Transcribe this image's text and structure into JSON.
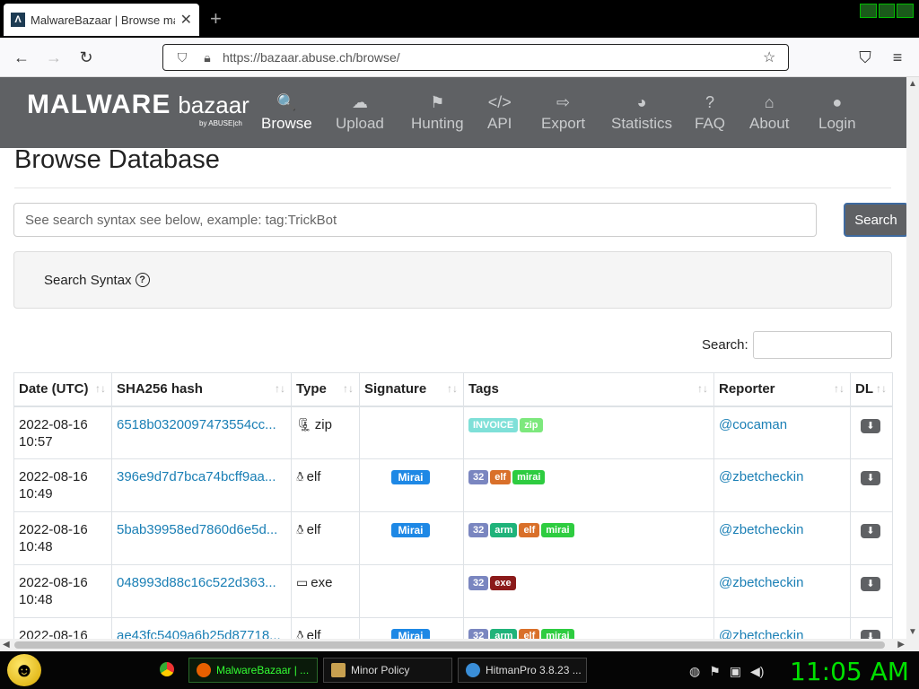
{
  "browser": {
    "tab_title": "MalwareBazaar | Browse malw...",
    "favicon_letter": "Λ",
    "url": "https://bazaar.abuse.ch/browse/"
  },
  "navbar": {
    "logo": "MALWARE",
    "logo_light": "bazaar",
    "logo_sub": "by ABUSE|ch",
    "items": [
      {
        "label": "Browse",
        "icon": "search-icon",
        "glyph": "🔍"
      },
      {
        "label": "Upload",
        "icon": "cloud-upload-icon",
        "glyph": "☁"
      },
      {
        "label": "Hunting",
        "icon": "hunting-icon",
        "glyph": "⚑"
      },
      {
        "label": "API",
        "icon": "code-icon",
        "glyph": "</>"
      },
      {
        "label": "Export",
        "icon": "export-icon",
        "glyph": "⇨"
      },
      {
        "label": "Statistics",
        "icon": "pie-chart-icon",
        "glyph": "◕"
      },
      {
        "label": "FAQ",
        "icon": "question-icon",
        "glyph": "?"
      },
      {
        "label": "About",
        "icon": "building-icon",
        "glyph": "⌂"
      },
      {
        "label": "Login",
        "icon": "user-icon",
        "glyph": "●"
      }
    ]
  },
  "page": {
    "title": "Browse Database",
    "search_placeholder": "See search syntax see below, example: tag:TrickBot",
    "search_button": "Search",
    "syntax_label": "Search Syntax",
    "table_search_label": "Search:"
  },
  "table": {
    "headers": [
      "Date (UTC)",
      "SHA256 hash",
      "Type",
      "Signature",
      "Tags",
      "Reporter",
      "DL"
    ],
    "rows": [
      {
        "date": "2022-08-16",
        "time": "10:57",
        "hash": "6518b0320097473554cc...",
        "type": "zip",
        "type_icon": "zip-file-icon",
        "signature": "",
        "tags": [
          {
            "t": "INVOICE",
            "c": "#7fe0d8"
          },
          {
            "t": "zip",
            "c": "#7de87d"
          }
        ],
        "reporter": "@cocaman"
      },
      {
        "date": "2022-08-16",
        "time": "10:49",
        "hash": "396e9d7d7bca74bcff9aa...",
        "type": "elf",
        "type_icon": "linux-icon",
        "signature": "Mirai",
        "tags": [
          {
            "t": "32",
            "c": "#7a86c0"
          },
          {
            "t": "elf",
            "c": "#d9702a"
          },
          {
            "t": "mirai",
            "c": "#2ecc40"
          }
        ],
        "reporter": "@zbetcheckin"
      },
      {
        "date": "2022-08-16",
        "time": "10:48",
        "hash": "5bab39958ed7860d6e5d...",
        "type": "elf",
        "type_icon": "linux-icon",
        "signature": "Mirai",
        "tags": [
          {
            "t": "32",
            "c": "#7a86c0"
          },
          {
            "t": "arm",
            "c": "#1fb37a"
          },
          {
            "t": "elf",
            "c": "#d9702a"
          },
          {
            "t": "mirai",
            "c": "#2ecc40"
          }
        ],
        "reporter": "@zbetcheckin"
      },
      {
        "date": "2022-08-16",
        "time": "10:48",
        "hash": "048993d88c16c522d363...",
        "type": "exe",
        "type_icon": "window-icon",
        "signature": "",
        "tags": [
          {
            "t": "32",
            "c": "#7a86c0"
          },
          {
            "t": "exe",
            "c": "#8b1a1a"
          }
        ],
        "reporter": "@zbetcheckin"
      },
      {
        "date": "2022-08-16",
        "time": "",
        "hash": "ae43fc5409a6b25d87718...",
        "type": "elf",
        "type_icon": "linux-icon",
        "signature": "Mirai",
        "tags": [
          {
            "t": "32",
            "c": "#7a86c0"
          },
          {
            "t": "arm",
            "c": "#1fb37a"
          },
          {
            "t": "elf",
            "c": "#d9702a"
          },
          {
            "t": "mirai",
            "c": "#2ecc40"
          }
        ],
        "reporter": "@zbetcheckin"
      }
    ]
  },
  "colors": {
    "signature_badge": "#1e88e5",
    "navbar": "#5f6164",
    "link": "#1a7fb5"
  },
  "taskbar": {
    "items": [
      {
        "label": "MalwareBazaar | ...",
        "icon": "firefox-icon",
        "active": true
      },
      {
        "label": "Minor Policy",
        "icon": "document-icon",
        "active": false
      },
      {
        "label": "HitmanPro 3.8.23 ...",
        "icon": "hitmanpro-icon",
        "active": false
      }
    ],
    "clock": "11:05 AM"
  }
}
